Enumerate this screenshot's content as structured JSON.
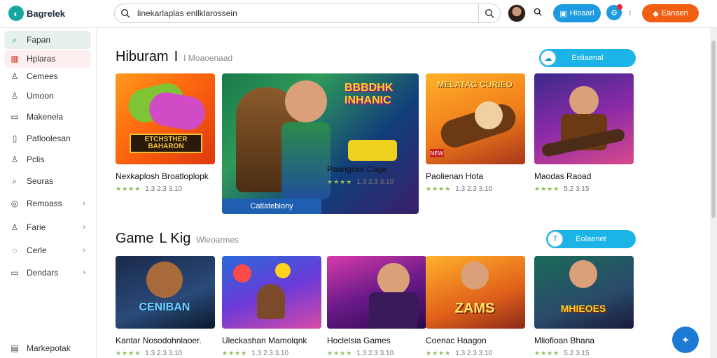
{
  "app": {
    "logo_text": "Bagrelek"
  },
  "search": {
    "value": "linekarlaplas enllklarossein"
  },
  "topbar": {
    "primary_label": "Hloaarl",
    "orange_label": "Eanaen"
  },
  "sidebar": {
    "items": [
      {
        "label": "Fapan",
        "icon": "search-icon"
      },
      {
        "label": "Hplaras",
        "icon": "game-icon"
      },
      {
        "label": "Cemees",
        "icon": "user-icon"
      },
      {
        "label": "Umoon",
        "icon": "user-icon"
      },
      {
        "label": "Makenela",
        "icon": "book-icon"
      },
      {
        "label": "Pafloolesan",
        "icon": "file-icon"
      },
      {
        "label": "Pclis",
        "icon": "user-icon"
      },
      {
        "label": "Seuras",
        "icon": "search-icon"
      },
      {
        "label": "Remoass",
        "icon": "target-icon"
      },
      {
        "label": "Farie",
        "icon": "user-icon"
      },
      {
        "label": "Cerle",
        "icon": "chat-icon"
      },
      {
        "label": "Dendars",
        "icon": "book-icon"
      }
    ],
    "footer_label": "Markepotak"
  },
  "sections": [
    {
      "title": "Hiburam",
      "title_mark": "I",
      "subtitle": "I Moaoenaad",
      "button_label": "Eoliaenal"
    },
    {
      "title": "Game",
      "title_mark": "L Kig",
      "subtitle": "Wleoarmes",
      "button_label": "Eolaenet"
    }
  ],
  "feature": {
    "caption": "Catlateblony",
    "headline": "BBBDHK INHANIC"
  },
  "row1": [
    {
      "title": "Nexkaplosh Broatloplopk",
      "rating": "1.3 2.3 3.10",
      "art": "ETCHSTHER BAHARON"
    },
    {
      "title": "Paanglool Cage",
      "rating": "1.3 2.3 3.10",
      "art": ""
    },
    {
      "title": "Paolienan Hota",
      "rating": "1.3 2.3 3.10",
      "art": "MELATAG CURIEO"
    },
    {
      "title": "Maodas Raoad",
      "rating": "5.2 3.15",
      "art": ""
    }
  ],
  "row2": [
    {
      "title": "Kantar Nosodohnlaoer.",
      "rating": "1.3 2.3 3.10",
      "art": "CENIBAN"
    },
    {
      "title": "Uleckashan Mamolqnk",
      "rating": "1.3 2.3 3.10",
      "art": ""
    },
    {
      "title": "Hoclelsia Games",
      "rating": "1.3 2.3 3.10",
      "art": ""
    },
    {
      "title": "Coenac Haagon",
      "rating": "1.3 2.3 3.10",
      "art": "ZAMS"
    },
    {
      "title": "Mliofioan Bhana",
      "rating": "5.2 3.15",
      "art": "MHIEOES"
    }
  ],
  "colors": {
    "accent": "#1d9ae0",
    "orange": "#f35f12",
    "cyan": "#1cb3e6",
    "sidebar_active": "#e6f1ee"
  }
}
